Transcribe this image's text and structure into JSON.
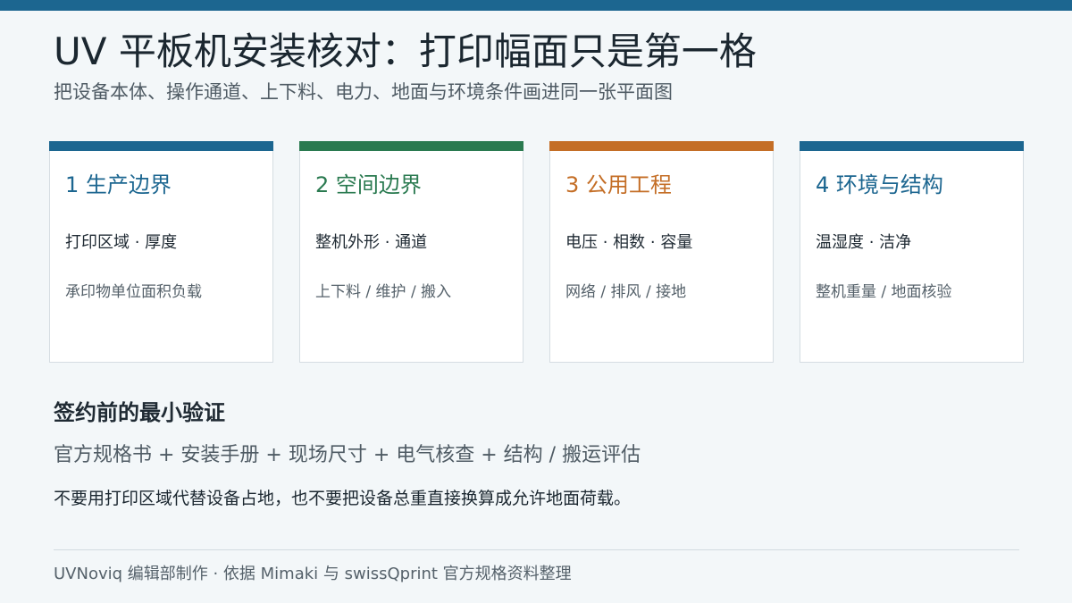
{
  "header": {
    "title": "UV 平板机安装核对：打印幅面只是第一格",
    "subtitle": "把设备本体、操作通道、上下料、电力、地面与环境条件画进同一张平面图"
  },
  "cards": [
    {
      "title": "1  生产边界",
      "main": "打印区域 · 厚度",
      "sub": "承印物单位面积负载",
      "accent": "#1c6690"
    },
    {
      "title": "2  空间边界",
      "main": "整机外形 · 通道",
      "sub": "上下料 / 维护 / 搬入",
      "accent": "#2a7a50"
    },
    {
      "title": "3  公用工程",
      "main": "电压 · 相数 · 容量",
      "sub": "网络 / 排风 / 接地",
      "accent": "#c46e26"
    },
    {
      "title": "4  环境与结构",
      "main": "温湿度 · 洁净",
      "sub": "整机重量 / 地面核验",
      "accent": "#1c6690"
    }
  ],
  "verification": {
    "heading": "签约前的最小验证",
    "items": "官方规格书 + 安装手册 + 现场尺寸 + 电气核查 + 结构 / 搬运评估",
    "warning": "不要用打印区域代替设备占地，也不要把设备总重直接换算成允许地面荷载。"
  },
  "footer": {
    "text": "UVNoviq 编辑部制作 · 依据 Mimaki 与 swissQprint 官方规格资料整理"
  },
  "colors": {
    "top_bar": "#1c6690",
    "background": "#f3f7f9"
  }
}
